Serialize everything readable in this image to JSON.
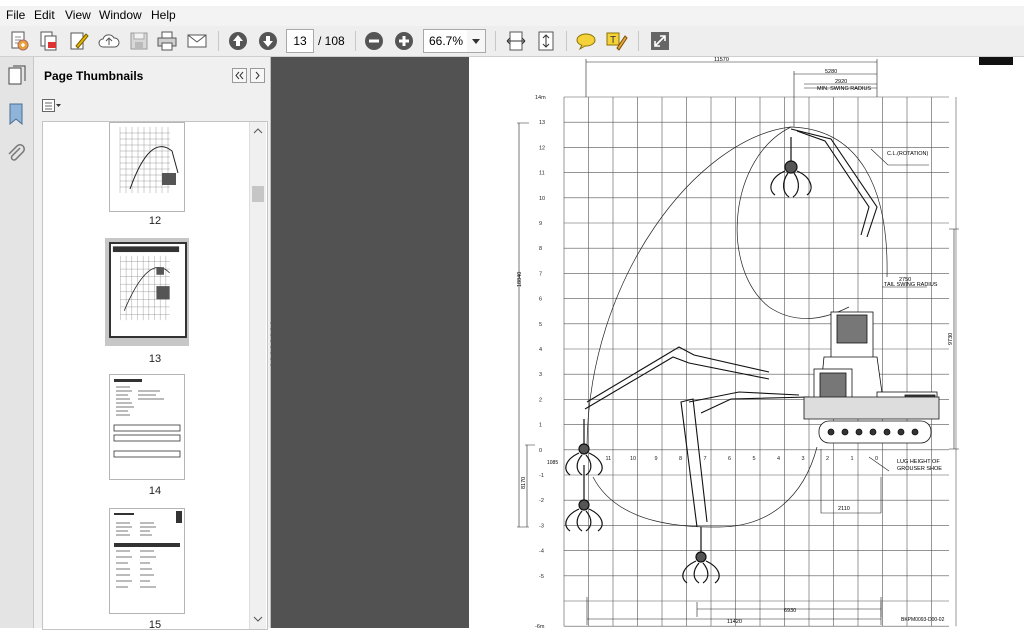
{
  "window": {
    "title": ""
  },
  "menu": {
    "file": "File",
    "edit": "Edit",
    "view": "View",
    "window": "Window",
    "help": "Help"
  },
  "toolbar": {
    "current_page": "13",
    "total_pages": "/ 108",
    "zoom": "66.7%",
    "icons": [
      "create-icon",
      "combine-icon",
      "edit-icon",
      "cloud-icon",
      "save-icon",
      "print-icon",
      "email-icon",
      "prev-page-icon",
      "next-page-icon",
      "zoom-out-icon",
      "zoom-in-icon",
      "fit-width-icon",
      "fit-page-icon",
      "comment-icon",
      "highlight-icon",
      "fullscreen-icon"
    ]
  },
  "sidebar": {
    "title": "Page Thumbnails",
    "thumbnails": [
      {
        "label": "12",
        "selected": false
      },
      {
        "label": "13",
        "selected": true
      },
      {
        "label": "14",
        "selected": false
      },
      {
        "label": "15",
        "selected": false
      }
    ]
  },
  "drawing": {
    "top_dims": [
      "11570",
      "5280",
      "2920"
    ],
    "min_swing": "MIN. SWING RADIUS",
    "cl_rotation": "C.L.(ROTATION)",
    "tail_dim": "2750",
    "tail_swing": "TAIL SWING RADIUS",
    "lug_height_1": "LUG HEIGHT OF",
    "lug_height_2": "GROUSER SHOE",
    "left_dim_height": "18840",
    "left_dim_depth": "8170",
    "right_dim_height": "9730",
    "bottom_dim_1": "2110",
    "bottom_dim_2": "6930",
    "bottom_dim_3": "11420",
    "ground_label": "1085",
    "ref": "BKPM0093-D00-02",
    "y_top": "14m",
    "y_bottom": "-6m",
    "y_ticks": [
      "13",
      "12",
      "11",
      "10",
      "9",
      "8",
      "7",
      "6",
      "5",
      "4",
      "3",
      "2",
      "1",
      "0",
      "-1",
      "-2",
      "-3",
      "-4",
      "-5"
    ],
    "x_ticks": [
      "11",
      "10",
      "9",
      "8",
      "7",
      "6",
      "5",
      "4",
      "3",
      "2",
      "1",
      "0"
    ]
  }
}
